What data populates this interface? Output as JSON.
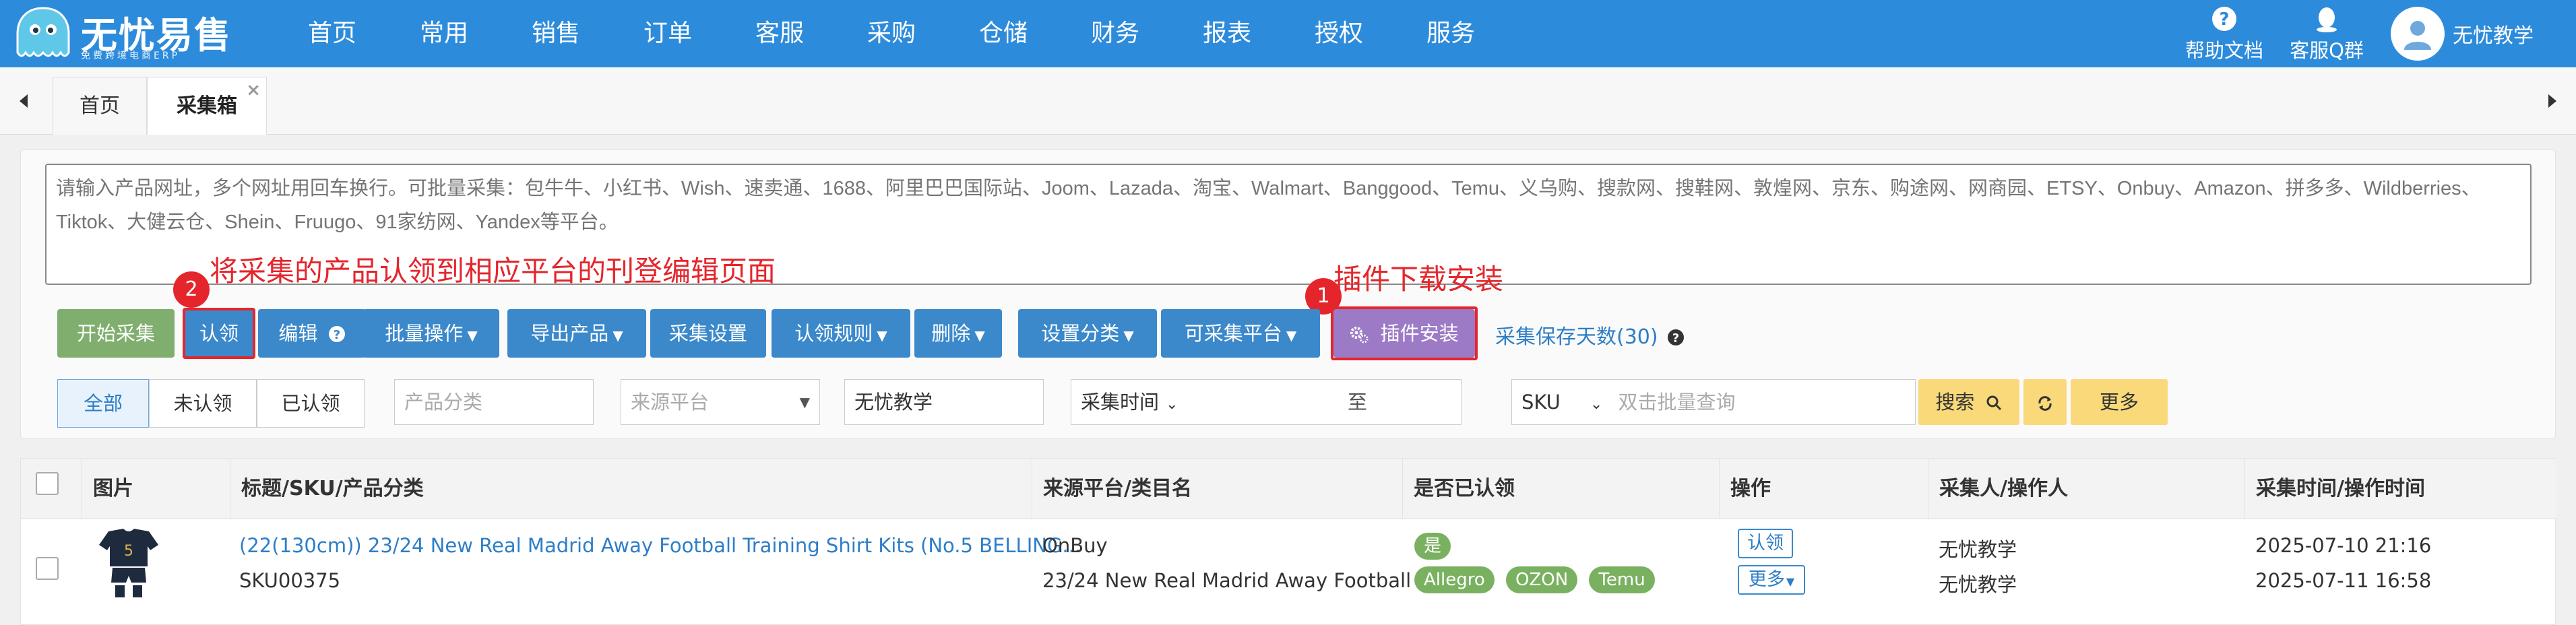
{
  "brand": {
    "name": "无忧易售",
    "sub": "免费跨境电商ERP"
  },
  "menu": [
    "首页",
    "常用",
    "销售",
    "订单",
    "客服",
    "采购",
    "仓储",
    "财务",
    "报表",
    "授权",
    "服务"
  ],
  "header_right": {
    "help": "帮助文档",
    "qq": "客服Q群",
    "user": "无忧教学"
  },
  "tabs": [
    {
      "label": "首页"
    },
    {
      "label": "采集箱",
      "close": "×"
    }
  ],
  "collect": {
    "url_placeholder": "请输入产品网址，多个网址用回车换行。可批量采集：包牛牛、小红书、Wish、速卖通、1688、阿里巴巴国际站、Joom、Lazada、淘宝、Walmart、Banggood、Temu、义乌购、搜款网、搜鞋网、敦煌网、京东、购途网、网商园、ETSY、Onbuy、Amazon、拼多多、Wildberries、Tiktok、大健云仓、Shein、Fruugo、91家纺网、Yandex等平台。"
  },
  "annotations": {
    "claim_note": "将采集的产品认领到相应平台的刊登编辑页面",
    "plugin_note": "插件下载安装",
    "badge1": "1",
    "badge2": "2"
  },
  "toolbar": {
    "start": "开始采集",
    "claim": "认领",
    "edit": "编辑",
    "batch": "批量操作",
    "export": "导出产品",
    "settings": "采集设置",
    "rules": "认领规则",
    "delete": "删除",
    "category": "设置分类",
    "platforms": "可采集平台",
    "plugin": "插件安装",
    "save_days": "采集保存天数(30)"
  },
  "filters": {
    "status_tabs": [
      "全部",
      "未认领",
      "已认领"
    ],
    "category_placeholder": "产品分类",
    "source_placeholder": "来源平台",
    "collector_value": "无忧教学",
    "time_label": "采集时间",
    "to": "至",
    "sku_select": "SKU",
    "sku_placeholder": "双击批量查询",
    "search": "搜索",
    "more": "更多"
  },
  "table": {
    "headers": [
      "图片",
      "标题/SKU/产品分类",
      "来源平台/类目名",
      "是否已认领",
      "操作",
      "采集人/操作人",
      "采集时间/操作时间"
    ],
    "rows": [
      {
        "title": "(22(130cm)) 23/24 New Real Madrid Away Football Training Shirt Kits (No.5 BELLING...",
        "sku": "SKU00375",
        "platform": "OnBuy",
        "category": "23/24 New Real Madrid Away Football ...",
        "claimed": "是",
        "claimed_platforms": [
          "Allegro",
          "OZON",
          "Temu"
        ],
        "claim_btn": "认领",
        "more_btn": "更多",
        "collector": "无忧教学",
        "operator": "无忧教学",
        "collected_at": "2025-07-10 21:16",
        "operated_at": "2025-07-11 16:58"
      }
    ]
  },
  "colors": {
    "nav": "#2d8bdb",
    "primary": "#3b88cb",
    "green": "#7fae6e",
    "purple": "#9c7ac6",
    "annotation": "#e4262c",
    "pill": "#7ab160"
  }
}
